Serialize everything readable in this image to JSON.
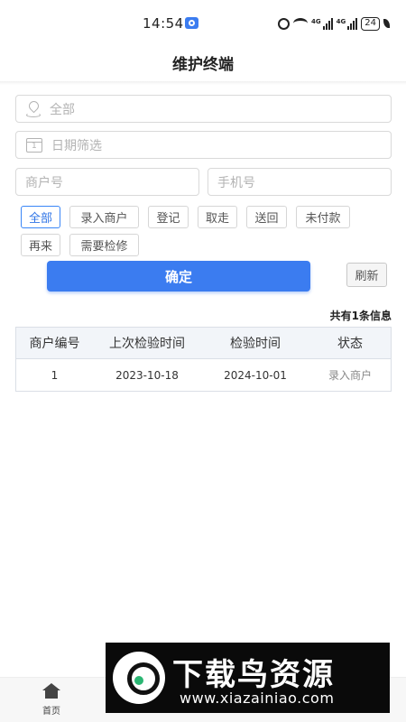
{
  "status_bar": {
    "time": "14:54",
    "battery": "24",
    "network_labels": [
      "4G",
      "4G"
    ]
  },
  "header": {
    "title": "维护终端"
  },
  "filters": {
    "region_placeholder": "全部",
    "date_placeholder": "日期筛选",
    "merchant_placeholder": "商户号",
    "phone_placeholder": "手机号"
  },
  "status_chips": [
    {
      "label": "全部",
      "active": true
    },
    {
      "label": "录入商户"
    },
    {
      "label": "登记"
    },
    {
      "label": "取走"
    },
    {
      "label": "送回"
    },
    {
      "label": "未付款"
    },
    {
      "label": "再来"
    },
    {
      "label": "需要检修"
    }
  ],
  "actions": {
    "confirm_label": "确定",
    "refresh_label": "刷新"
  },
  "summary": {
    "count_text": "共有1条信息"
  },
  "table": {
    "headers": [
      "商户编号",
      "上次检验时间",
      "检验时间",
      "状态"
    ],
    "rows": [
      {
        "merchant_no": "1",
        "last_inspection": "2023-10-18",
        "inspection": "2024-10-01",
        "status": "录入商户"
      }
    ]
  },
  "bottom_nav": {
    "home_label": "首页"
  },
  "watermark": {
    "title": "下载鸟资源",
    "url": "www.xiazainiao.com"
  },
  "colors": {
    "primary": "#3b7cf0",
    "chip_active": "#2f74e6",
    "table_header_bg": "#f2f5f9"
  },
  "icons": [
    "location-icon",
    "calendar-icon",
    "home-icon",
    "alarm-icon",
    "wifi-icon",
    "signal-icon",
    "battery-icon"
  ]
}
